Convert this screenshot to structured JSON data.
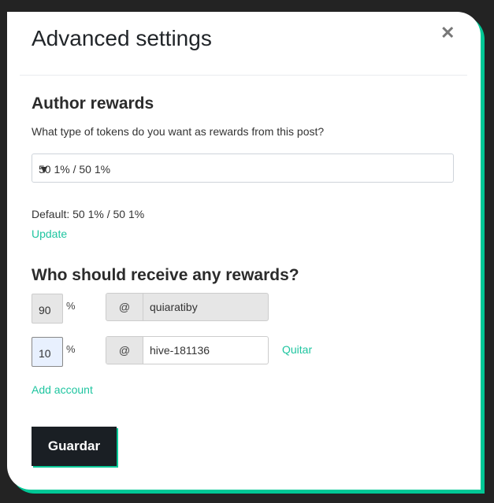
{
  "modal": {
    "title": "Advanced settings",
    "close_icon": "close-icon",
    "author_rewards": {
      "heading": "Author rewards",
      "question": "What type of tokens do you want as rewards from this post?",
      "selected": "50 1% / 50 1%",
      "default_text": "Default: 50 1% / 50 1%",
      "update_label": "Update"
    },
    "beneficiaries": {
      "heading": "Who should receive any rewards?",
      "rows": [
        {
          "percent": "90",
          "percent_sign": "%",
          "at": "@",
          "account": "quiaratiby"
        },
        {
          "percent": "10",
          "percent_sign": "%",
          "at": "@",
          "account": "hive-181136",
          "remove_label": "Quitar"
        }
      ],
      "add_label": "Add account"
    },
    "save_label": "Guardar",
    "accent_color": "#00c896"
  }
}
